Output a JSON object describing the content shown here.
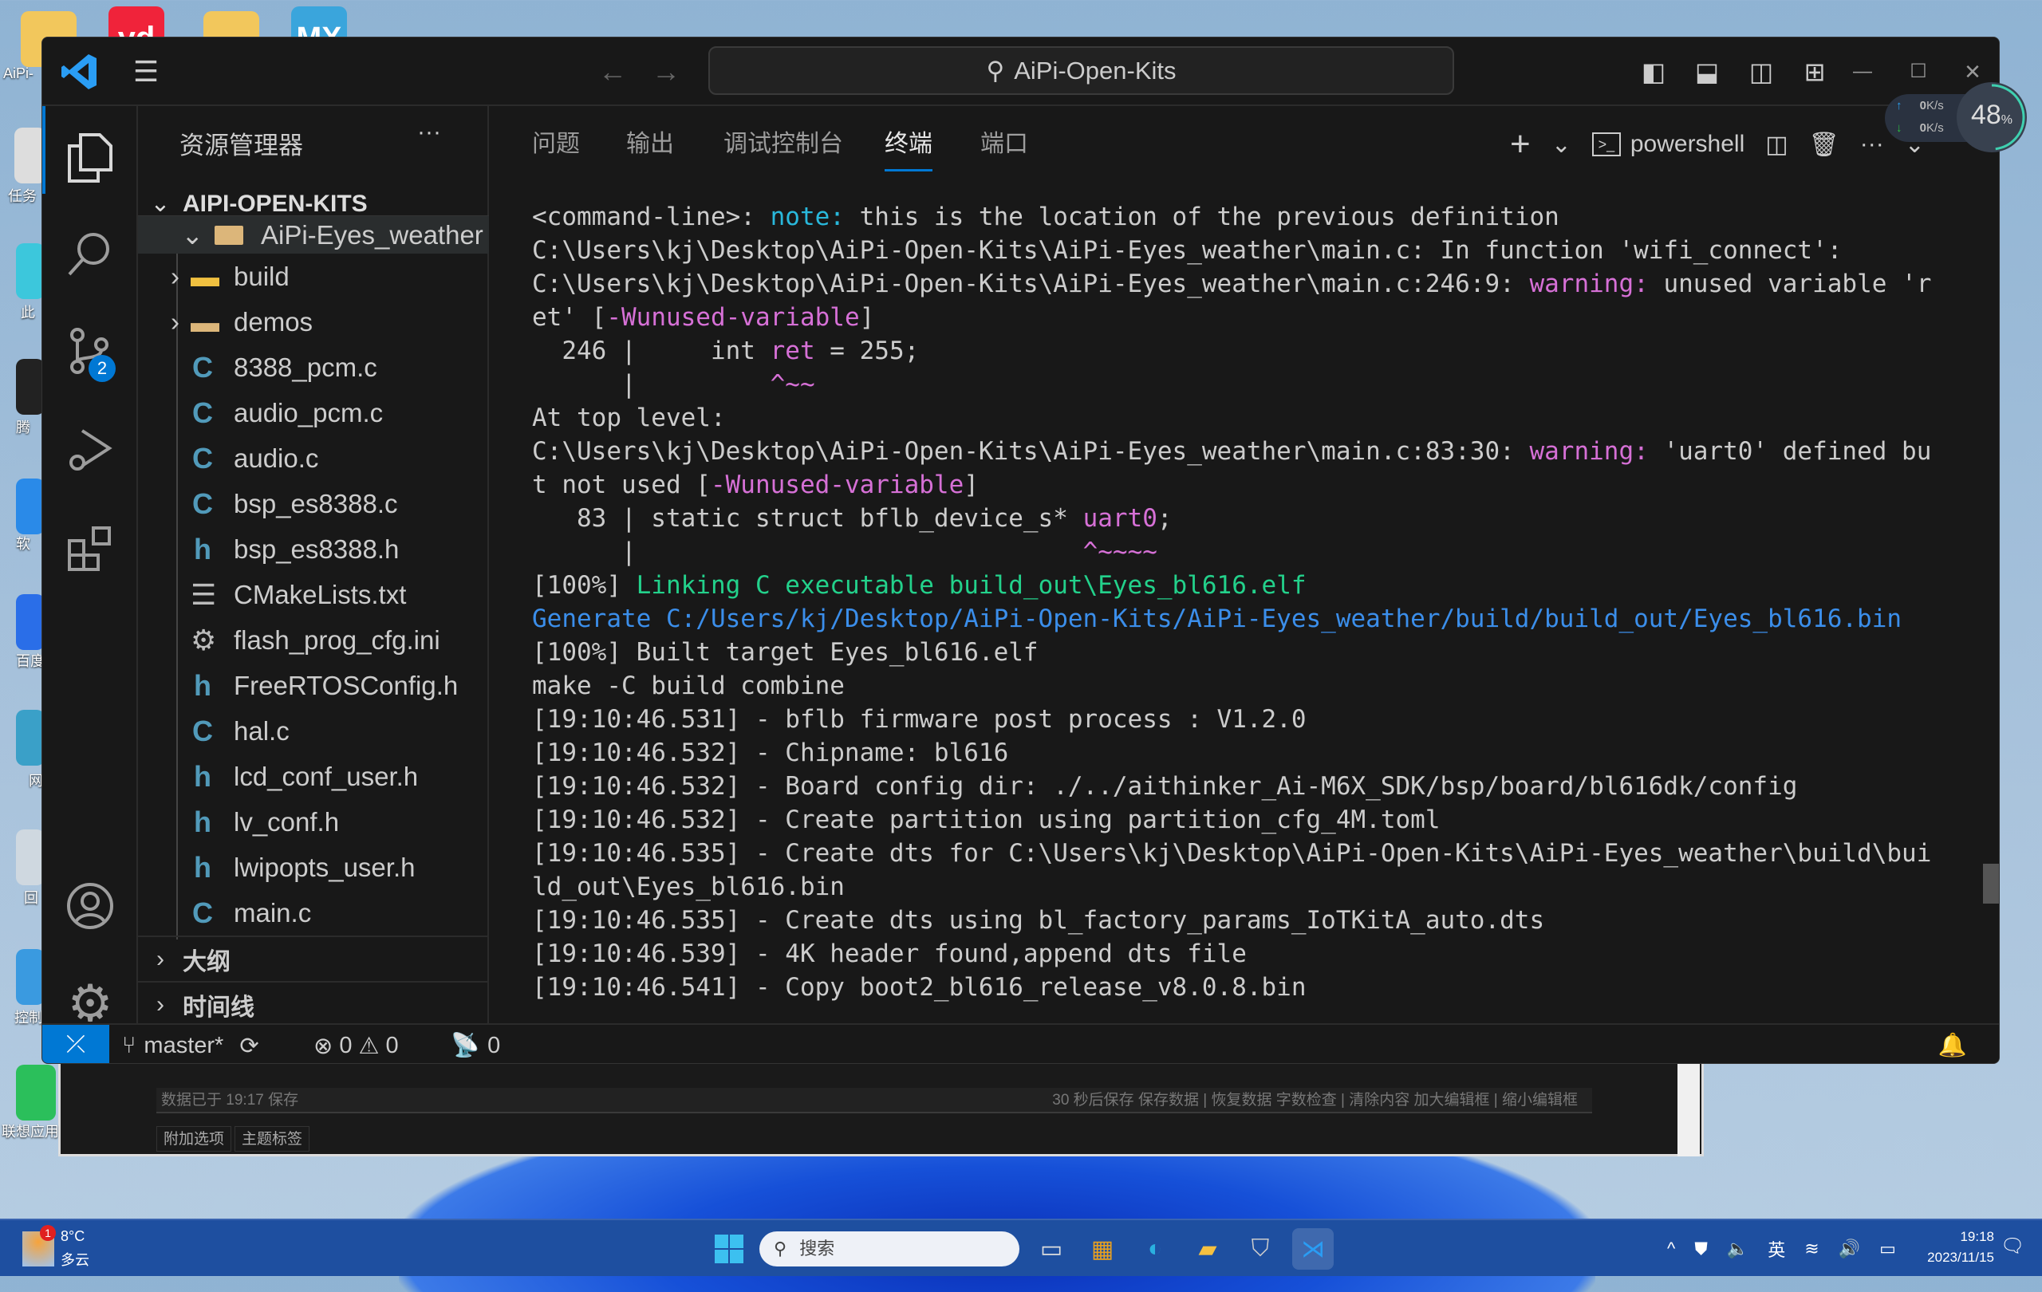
{
  "desktop": {
    "icons": [
      {
        "label": "AiPi-"
      },
      {
        "label": "任务"
      },
      {
        "label": "此"
      },
      {
        "label": "腾"
      },
      {
        "label": "软"
      },
      {
        "label": "百度"
      },
      {
        "label": "网"
      },
      {
        "label": "回"
      },
      {
        "label": "控制"
      },
      {
        "label": "联想应用"
      }
    ],
    "top_icons": [
      "yd",
      "MX"
    ]
  },
  "titlebar": {
    "search": "AiPi-Open-Kits"
  },
  "activity": {
    "scm_badge": "2"
  },
  "sidebar": {
    "title": "资源管理器",
    "more": "···",
    "root": "AIPI-OPEN-KITS",
    "folder": "AiPi-Eyes_weather",
    "items": [
      {
        "label": "build",
        "type": "folder-special"
      },
      {
        "label": "demos",
        "type": "folder"
      },
      {
        "label": "8388_pcm.c",
        "type": "c"
      },
      {
        "label": "audio_pcm.c",
        "type": "c"
      },
      {
        "label": "audio.c",
        "type": "c"
      },
      {
        "label": "bsp_es8388.c",
        "type": "c"
      },
      {
        "label": "bsp_es8388.h",
        "type": "h"
      },
      {
        "label": "CMakeLists.txt",
        "type": "txt"
      },
      {
        "label": "flash_prog_cfg.ini",
        "type": "ini"
      },
      {
        "label": "FreeRTOSConfig.h",
        "type": "h"
      },
      {
        "label": "hal.c",
        "type": "c"
      },
      {
        "label": "lcd_conf_user.h",
        "type": "h"
      },
      {
        "label": "lv_conf.h",
        "type": "h"
      },
      {
        "label": "lwipopts_user.h",
        "type": "h"
      },
      {
        "label": "main.c",
        "type": "c"
      }
    ],
    "outline": "大纲",
    "timeline": "时间线"
  },
  "panel": {
    "tabs": [
      "问题",
      "输出",
      "调试控制台",
      "终端",
      "端口"
    ],
    "active_tab": "终端",
    "shell": "powershell"
  },
  "terminal": {
    "lines": [
      [
        [
          "<command-line>: ",
          "def"
        ],
        [
          "note:",
          "note"
        ],
        [
          " this is the location of the previous definition",
          "def"
        ]
      ],
      [
        [
          "C:\\Users\\kj\\Desktop\\AiPi-Open-Kits\\AiPi-Eyes_weather\\main.c: In function 'wifi_connect':",
          "def"
        ]
      ],
      [
        [
          "C:\\Users\\kj\\Desktop\\AiPi-Open-Kits\\AiPi-Eyes_weather\\main.c:246:9: ",
          "def"
        ],
        [
          "warning:",
          "warn"
        ],
        [
          " unused variable 'r",
          "def"
        ]
      ],
      [
        [
          "et' [",
          "def"
        ],
        [
          "-Wunused-variable",
          "warn"
        ],
        [
          "]",
          "def"
        ]
      ],
      [
        [
          "  246 |     int ",
          "def"
        ],
        [
          "ret",
          "warn"
        ],
        [
          " = 255;",
          "def"
        ]
      ],
      [
        [
          "      |         ",
          "def"
        ],
        [
          "^~~",
          "warn"
        ]
      ],
      [
        [
          "At top level:",
          "def"
        ]
      ],
      [
        [
          "C:\\Users\\kj\\Desktop\\AiPi-Open-Kits\\AiPi-Eyes_weather\\main.c:83:30: ",
          "def"
        ],
        [
          "warning:",
          "warn"
        ],
        [
          " 'uart0' defined bu",
          "def"
        ]
      ],
      [
        [
          "t not used [",
          "def"
        ],
        [
          "-Wunused-variable",
          "warn"
        ],
        [
          "]",
          "def"
        ]
      ],
      [
        [
          "   83 | static struct bflb_device_s* ",
          "def"
        ],
        [
          "uart0",
          "warn"
        ],
        [
          ";",
          "def"
        ]
      ],
      [
        [
          "      |                              ",
          "def"
        ],
        [
          "^~~~~",
          "warn"
        ]
      ],
      [
        [
          "[100%] ",
          "def"
        ],
        [
          "Linking C executable build_out\\Eyes_bl616.elf",
          "green"
        ]
      ],
      [
        [
          "Generate C:/Users/kj/Desktop/AiPi-Open-Kits/AiPi-Eyes_weather/build/build_out/Eyes_bl616.bin",
          "blue"
        ]
      ],
      [
        [
          "[100%] Built target Eyes_bl616.elf",
          "def"
        ]
      ],
      [
        [
          "make -C build combine",
          "def"
        ]
      ],
      [
        [
          "[19:10:46.531] - bflb firmware post process : V1.2.0",
          "def"
        ]
      ],
      [
        [
          "[19:10:46.532] - Chipname: bl616",
          "def"
        ]
      ],
      [
        [
          "[19:10:46.532] - Board config dir: ./../aithinker_Ai-M6X_SDK/bsp/board/bl616dk/config",
          "def"
        ]
      ],
      [
        [
          "[19:10:46.532] - Create partition using partition_cfg_4M.toml",
          "def"
        ]
      ],
      [
        [
          "[19:10:46.535] - Create dts for C:\\Users\\kj\\Desktop\\AiPi-Open-Kits\\AiPi-Eyes_weather\\build\\bui",
          "def"
        ]
      ],
      [
        [
          "ld_out\\Eyes_bl616.bin",
          "def"
        ]
      ],
      [
        [
          "[19:10:46.535] - Create dts using bl_factory_params_IoTKitA_auto.dts",
          "def"
        ]
      ],
      [
        [
          "[19:10:46.539] - 4K header found,append dts file",
          "def"
        ]
      ],
      [
        [
          "[19:10:46.541] - Copy boot2_bl616_release_v8.0.8.bin",
          "def"
        ]
      ]
    ]
  },
  "statusbar": {
    "branch": "master*",
    "errors": "0",
    "warnings": "0",
    "ports": "0"
  },
  "netwidget": {
    "up": "0",
    "down": "0",
    "unit": "K/s",
    "cpu": "48",
    "cpu_unit": "%",
    "cpu_fraction": 0.48
  },
  "lower_window": {
    "saved": "数据已于 19:17 保存",
    "actions": "30 秒后保存 保存数据 | 恢复数据    字数检查 | 清除内容    加大编辑框 | 缩小编辑框",
    "tabs": [
      "附加选项",
      "主题标签"
    ]
  },
  "taskbar": {
    "temp": "8°C",
    "weather": "多云",
    "weather_badge": "1",
    "search": "搜索",
    "ime": "英",
    "time": "19:18",
    "date": "2023/11/15"
  },
  "colors": {
    "accent": "#0078d4",
    "warning": "#d670d6",
    "note": "#29b8db",
    "success": "#23d18b",
    "link": "#3b8eea"
  }
}
